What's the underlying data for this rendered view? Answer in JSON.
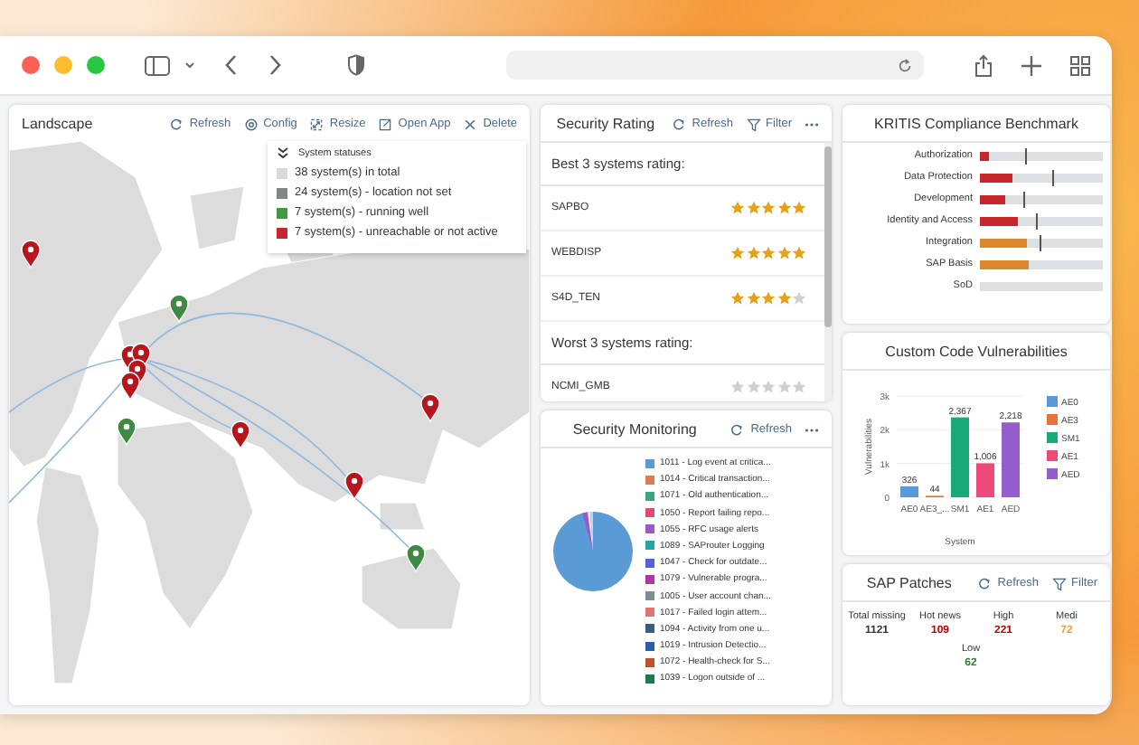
{
  "landscape": {
    "title": "Landscape",
    "actions": [
      {
        "kind": "refresh",
        "label": "Refresh"
      },
      {
        "kind": "config",
        "label": "Config"
      },
      {
        "kind": "resize",
        "label": "Resize"
      },
      {
        "kind": "open",
        "label": "Open App"
      },
      {
        "kind": "delete",
        "label": "Delete"
      }
    ],
    "legend": {
      "title": "System statuses",
      "items": [
        {
          "label": "38 system(s) in total",
          "color": "#d9d9d9"
        },
        {
          "label": "24 system(s) - location not set",
          "color": "#7f8688"
        },
        {
          "label": "7 system(s) - running well",
          "color": "#3f9a43"
        },
        {
          "label": "7 system(s) - unreachable or not active",
          "color": "#c8262d"
        }
      ]
    }
  },
  "security_rating": {
    "title": "Security Rating",
    "actions": [
      {
        "kind": "refresh",
        "label": "Refresh"
      },
      {
        "kind": "filter",
        "label": "Filter"
      },
      {
        "kind": "more"
      }
    ],
    "groups": [
      {
        "heading": "Best 3 systems rating:",
        "systems": [
          {
            "name": "SAPBO",
            "stars": 5
          },
          {
            "name": "WEBDISP",
            "stars": 5
          },
          {
            "name": "S4D_TEN",
            "stars": 4
          }
        ]
      },
      {
        "heading": "Worst 3 systems rating:",
        "systems": [
          {
            "name": "NCMI_GMB",
            "stars": 0
          }
        ]
      }
    ]
  },
  "security_monitoring": {
    "title": "Security Monitoring",
    "actions": [
      {
        "kind": "refresh",
        "label": "Refresh"
      },
      {
        "kind": "more"
      }
    ],
    "legend": [
      {
        "label": "1011 - Log event at critica...",
        "color": "#5b9bd5"
      },
      {
        "label": "1014 - Critical transaction...",
        "color": "#e07b4f"
      },
      {
        "label": "1071 - Old authentication...",
        "color": "#3aa57a"
      },
      {
        "label": "1050 - Report failing repo...",
        "color": "#e34b6e"
      },
      {
        "label": "1055 - RFC usage alerts",
        "color": "#9b59c8"
      },
      {
        "label": "1089 - SAProuter Logging",
        "color": "#26a3a3"
      },
      {
        "label": "1047 - Check for outdate...",
        "color": "#5561d8"
      },
      {
        "label": "1079 - Vulnerable progra...",
        "color": "#b3359c"
      },
      {
        "label": "1005 - User account chan...",
        "color": "#7d8c95"
      },
      {
        "label": "1017 - Failed login attem...",
        "color": "#e57373"
      },
      {
        "label": "1094 - Activity from one u...",
        "color": "#3a5a80"
      },
      {
        "label": "1019 - Intrusion Detectio...",
        "color": "#2a5caa"
      },
      {
        "label": "1072 - Health-check for S...",
        "color": "#c0522b"
      },
      {
        "label": "1039 - Logon outside of ...",
        "color": "#1e7a4a"
      }
    ]
  },
  "kritis": {
    "title": "KRITIS Compliance Benchmark",
    "rows": [
      {
        "label": "Authorization",
        "level": 0.08,
        "color": "#c8262d",
        "target": {
          "level": 0.37
        }
      },
      {
        "label": "Data Protection",
        "level": 0.26,
        "color": "#c8262d",
        "target": {
          "level": 0.59
        }
      },
      {
        "label": "Development",
        "level": 0.2,
        "color": "#c8262d",
        "target": {
          "level": 0.35
        }
      },
      {
        "label": "Identity and Access",
        "level": 0.31,
        "color": "#c8262d",
        "target": {
          "level": 0.46
        }
      },
      {
        "label": "Integration",
        "level": 0.38,
        "color": "#d9882e",
        "target": {
          "level": 0.49
        }
      },
      {
        "label": "SAP Basis",
        "level": 0.39,
        "color": "#d9882e"
      },
      {
        "label": "SoD"
      }
    ]
  },
  "custom_code": {
    "title": "Custom Code Vulnerabilities",
    "chart_data": {
      "type": "bar",
      "xlabel": "System",
      "ylabel": "Vulnerabilities",
      "categories": [
        "AE0",
        "AE3_...",
        "SM1",
        "AE1",
        "AED"
      ],
      "series": [
        {
          "name": "AE0",
          "color": "#5899da",
          "values": [
            326,
            null,
            null,
            null,
            null
          ]
        },
        {
          "name": "AE3",
          "color": "#e8743b",
          "values": [
            null,
            44,
            null,
            null,
            null
          ]
        },
        {
          "name": "SM1",
          "color": "#19a979",
          "values": [
            null,
            null,
            2367,
            null,
            null
          ]
        },
        {
          "name": "AE1",
          "color": "#ed4a7b",
          "values": [
            null,
            null,
            null,
            1006,
            null
          ]
        },
        {
          "name": "AED",
          "color": "#945ecf",
          "values": [
            null,
            null,
            null,
            null,
            2218
          ]
        }
      ],
      "ylim": [
        0,
        3000
      ],
      "yticks": [
        {
          "value": 0,
          "label": "0"
        },
        {
          "value": 1000,
          "label": "1k"
        },
        {
          "value": 2000,
          "label": "2k"
        },
        {
          "value": 3000,
          "label": "3k"
        }
      ],
      "legend": true,
      "value_labels": [
        "326",
        "44",
        "2,367",
        "1,006",
        "2,218"
      ]
    }
  },
  "sap_patches": {
    "title": "SAP Patches",
    "actions": [
      {
        "kind": "refresh",
        "label": "Refresh"
      },
      {
        "kind": "filter",
        "label": "Filter"
      }
    ],
    "stats": [
      {
        "label": "Total missing",
        "value": "1121",
        "color": "#32363a"
      },
      {
        "label": "Hot news",
        "value": "109",
        "color": "#bb0000"
      },
      {
        "label": "High",
        "value": "221",
        "color": "#bb0000"
      },
      {
        "label": "Medi",
        "value": "72",
        "color": "#e9a03b"
      },
      {
        "label": "Low",
        "value": "62",
        "color": "#2b7d2b"
      }
    ]
  }
}
